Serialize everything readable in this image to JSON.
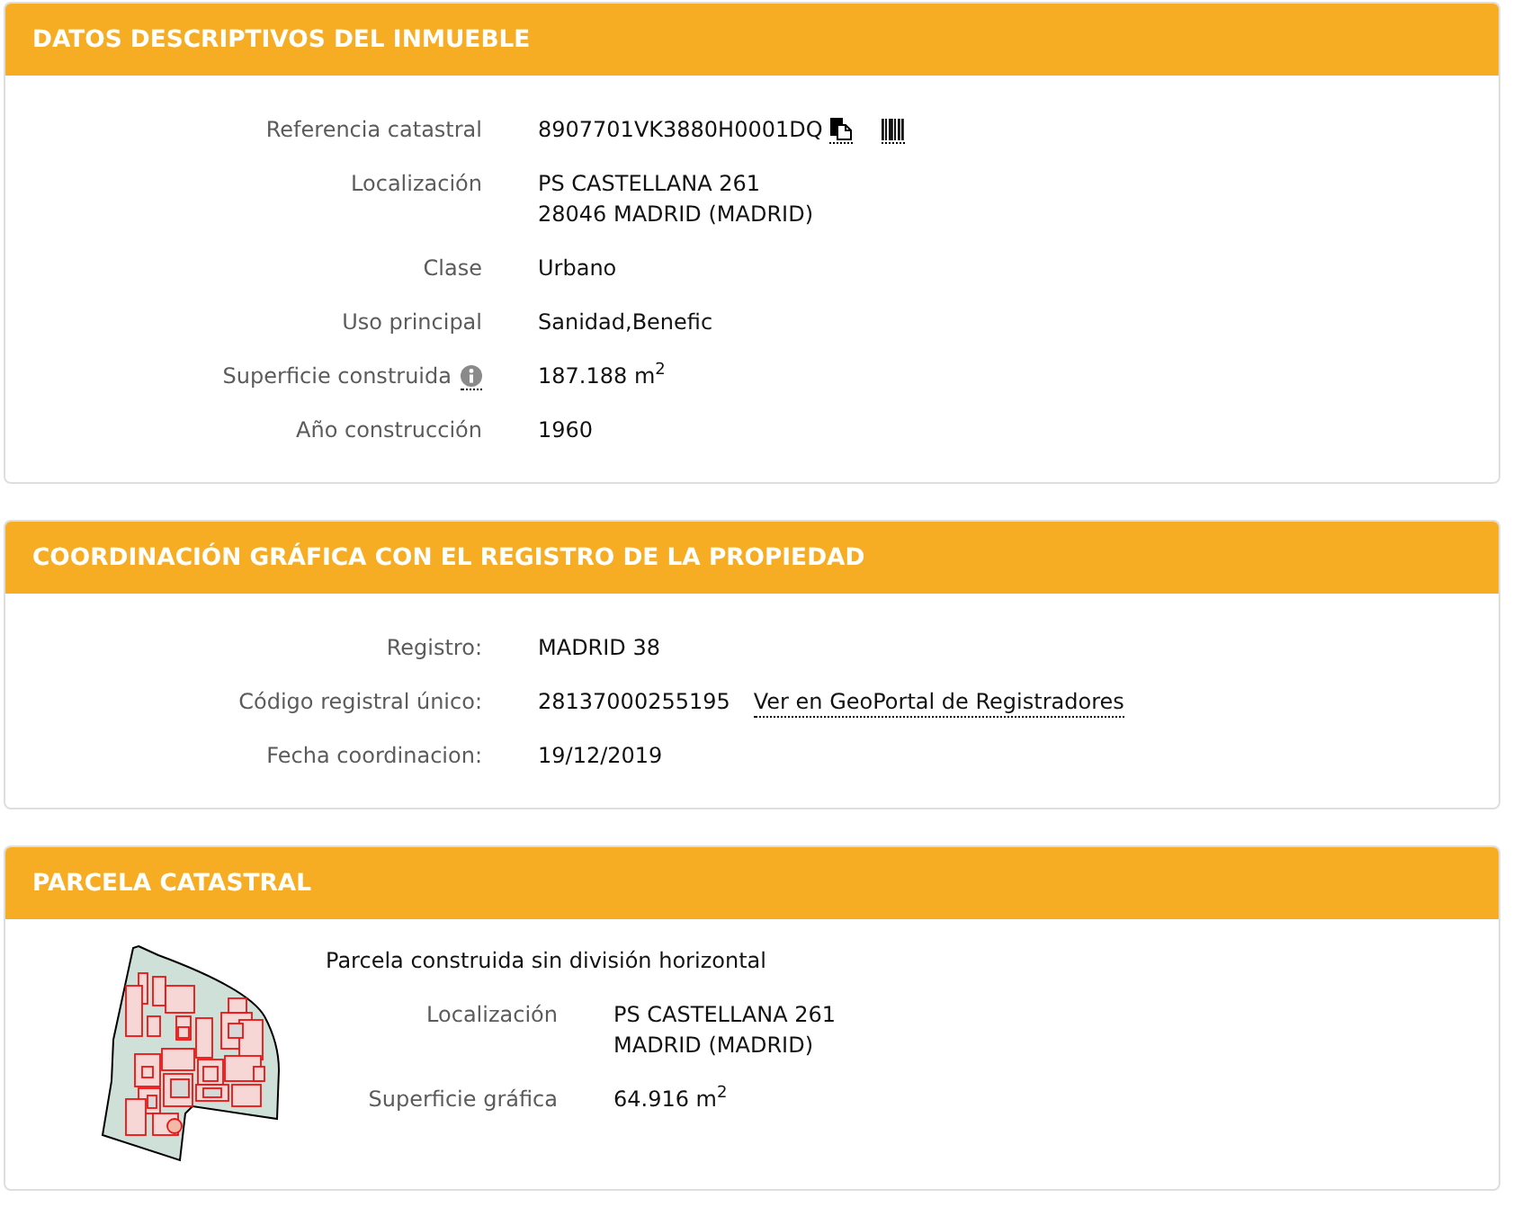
{
  "sections": [
    {
      "kind": "fields",
      "title": "DATOS DESCRIPTIVOS DEL INMUEBLE",
      "fields": [
        {
          "kind": "reference",
          "label": "Referencia catastral",
          "lines": [
            "8907701VK3880H0001DQ"
          ]
        },
        {
          "kind": "text",
          "label": "Localización",
          "lines": [
            "PS CASTELLANA 261",
            "28046 MADRID (MADRID)"
          ]
        },
        {
          "kind": "text",
          "label": "Clase",
          "lines": [
            "Urbano"
          ]
        },
        {
          "kind": "text",
          "label": "Uso principal",
          "lines": [
            "Sanidad,Benefic"
          ]
        },
        {
          "kind": "measure",
          "label": "Superficie construida",
          "lines": [
            "187.188 m$^{2}$"
          ]
        },
        {
          "kind": "text",
          "label": "Año construcción",
          "lines": [
            "1960"
          ]
        }
      ]
    },
    {
      "kind": "fields",
      "title": "COORDINACIÓN GRÁFICA CON EL REGISTRO DE LA PROPIEDAD",
      "fields": [
        {
          "kind": "text",
          "label": "Registro:",
          "lines": [
            "MADRID 38"
          ]
        },
        {
          "kind": "link",
          "label": "Código registral único:",
          "lines": [
            "28137000255195"
          ],
          "link": "Ver en GeoPortal de Registradores"
        },
        {
          "kind": "text",
          "label": "Fecha coordinacion:",
          "lines": [
            "19/12/2019"
          ]
        }
      ]
    },
    {
      "kind": "parcel",
      "title": "PARCELA CATASTRAL",
      "description": "Parcela construida sin división horizontal",
      "fields": [
        {
          "kind": "text",
          "label": "Localización",
          "lines": [
            "PS CASTELLANA 261",
            "MADRID (MADRID)"
          ]
        },
        {
          "kind": "text",
          "label": "Superficie gráfica",
          "lines": [
            "64.916 m$^{2}$"
          ]
        }
      ]
    }
  ]
}
